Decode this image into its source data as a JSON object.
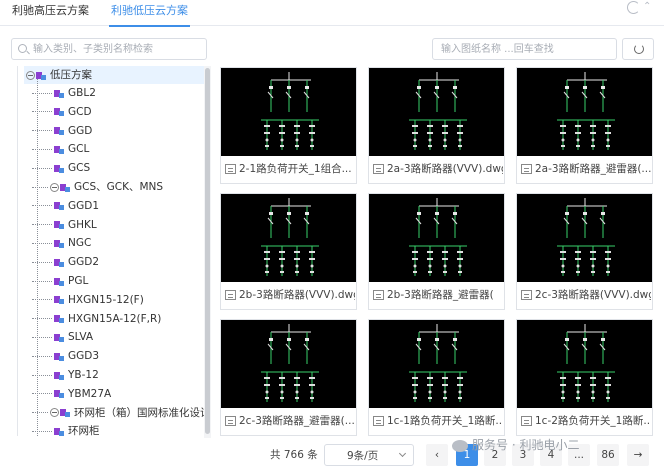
{
  "tabs": [
    {
      "label": "利驰高压云方案",
      "active": false
    },
    {
      "label": "利驰低压云方案",
      "active": true
    }
  ],
  "accent_color": "#3d8ee8",
  "left_search": {
    "placeholder": "输入类别、子类别名称检索"
  },
  "tree": {
    "root": "低压方案",
    "items": [
      {
        "label": "GBL2",
        "expandable": false
      },
      {
        "label": "GCD",
        "expandable": false
      },
      {
        "label": "GGD",
        "expandable": false
      },
      {
        "label": "GCL",
        "expandable": false
      },
      {
        "label": "GCS",
        "expandable": false
      },
      {
        "label": "GCS、GCK、MNS",
        "expandable": true
      },
      {
        "label": "GGD1",
        "expandable": false
      },
      {
        "label": "GHKL",
        "expandable": false
      },
      {
        "label": "NGC",
        "expandable": false
      },
      {
        "label": "GGD2",
        "expandable": false
      },
      {
        "label": "PGL",
        "expandable": false
      },
      {
        "label": "HXGN15-12(F)",
        "expandable": false
      },
      {
        "label": "HXGN15A-12(F,R)",
        "expandable": false
      },
      {
        "label": "SLVA",
        "expandable": false
      },
      {
        "label": "GGD3",
        "expandable": false
      },
      {
        "label": "YB-12",
        "expandable": false
      },
      {
        "label": "YBM27A",
        "expandable": false
      },
      {
        "label": "环网柜（箱）国网标准化设计",
        "expandable": true
      },
      {
        "label": "环网柜",
        "expandable": false
      }
    ]
  },
  "right_search": {
    "placeholder": "输入图纸名称 ...回车查找"
  },
  "cards": [
    {
      "name": "2-1路负荷开关_1组合..."
    },
    {
      "name": "2a-3路断路器(VVV).dwg"
    },
    {
      "name": "2a-3路断路器_避雷器(..."
    },
    {
      "name": "2b-3路断路器(VVV).dwg"
    },
    {
      "name": "2b-3路断路器_避雷器("
    },
    {
      "name": "2c-3路断路器(VVV).dwg"
    },
    {
      "name": "2c-3路断路器_避雷器(..."
    },
    {
      "name": "1c-1路负荷开关_1路断..."
    },
    {
      "name": "1c-2路负荷开关_1路断..."
    }
  ],
  "pagination": {
    "total_label": "共 766 条",
    "page_size_label": "9条/页",
    "pages": [
      "1",
      "2",
      "3",
      "4",
      "...",
      "86"
    ],
    "current_page": "1",
    "prev_icon": "‹",
    "next_icon": "→"
  },
  "watermark": "服务号 · 利驰电小二"
}
